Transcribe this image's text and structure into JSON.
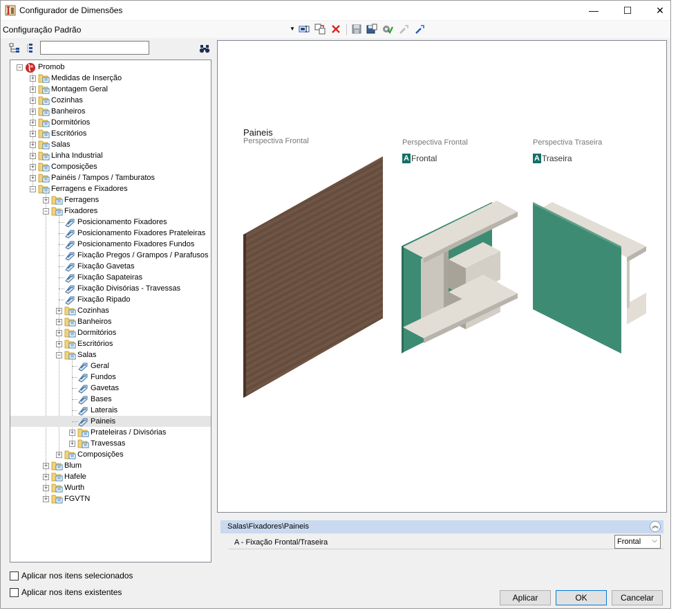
{
  "window": {
    "title": "Configurador de Dimensões",
    "minimize": "—",
    "maximize": "☐",
    "close": "✕"
  },
  "toolbar": {
    "config_label": "Configuração Padrão"
  },
  "search": {
    "value": "",
    "placeholder": ""
  },
  "tree": [
    {
      "label": "Promob",
      "depth": 0,
      "icon": "globe",
      "exp": "minus"
    },
    {
      "label": "Medidas de Inserção",
      "depth": 1,
      "icon": "folder",
      "exp": "plus"
    },
    {
      "label": "Montagem Geral",
      "depth": 1,
      "icon": "folder",
      "exp": "plus"
    },
    {
      "label": "Cozinhas",
      "depth": 1,
      "icon": "folder",
      "exp": "plus"
    },
    {
      "label": "Banheiros",
      "depth": 1,
      "icon": "folder",
      "exp": "plus"
    },
    {
      "label": "Dormitórios",
      "depth": 1,
      "icon": "folder",
      "exp": "plus"
    },
    {
      "label": "Escritórios",
      "depth": 1,
      "icon": "folder",
      "exp": "plus"
    },
    {
      "label": "Salas",
      "depth": 1,
      "icon": "folder",
      "exp": "plus"
    },
    {
      "label": "Linha Industrial",
      "depth": 1,
      "icon": "folder",
      "exp": "plus"
    },
    {
      "label": "Composições",
      "depth": 1,
      "icon": "folder",
      "exp": "plus"
    },
    {
      "label": "Painéis / Tampos / Tamburatos",
      "depth": 1,
      "icon": "folder",
      "exp": "plus"
    },
    {
      "label": "Ferragens e Fixadores",
      "depth": 1,
      "icon": "folder",
      "exp": "minus"
    },
    {
      "label": "Ferragens",
      "depth": 2,
      "icon": "folder",
      "exp": "plus"
    },
    {
      "label": "Fixadores",
      "depth": 2,
      "icon": "folder",
      "exp": "minus"
    },
    {
      "label": "Posicionamento Fixadores",
      "depth": 3,
      "icon": "tag",
      "exp": ""
    },
    {
      "label": "Posicionamento Fixadores Prateleiras",
      "depth": 3,
      "icon": "tag",
      "exp": ""
    },
    {
      "label": "Posicionamento Fixadores Fundos",
      "depth": 3,
      "icon": "tag",
      "exp": ""
    },
    {
      "label": "Fixação Pregos / Grampos / Parafusos",
      "depth": 3,
      "icon": "tag",
      "exp": ""
    },
    {
      "label": "Fixação Gavetas",
      "depth": 3,
      "icon": "tag",
      "exp": ""
    },
    {
      "label": "Fixação Sapateiras",
      "depth": 3,
      "icon": "tag",
      "exp": ""
    },
    {
      "label": "Fixação Divisórias - Travessas",
      "depth": 3,
      "icon": "tag",
      "exp": ""
    },
    {
      "label": "Fixação Ripado",
      "depth": 3,
      "icon": "tag",
      "exp": ""
    },
    {
      "label": "Cozinhas",
      "depth": 3,
      "icon": "folder",
      "exp": "plus"
    },
    {
      "label": "Banheiros",
      "depth": 3,
      "icon": "folder",
      "exp": "plus"
    },
    {
      "label": "Dormitórios",
      "depth": 3,
      "icon": "folder",
      "exp": "plus"
    },
    {
      "label": "Escritórios",
      "depth": 3,
      "icon": "folder",
      "exp": "plus"
    },
    {
      "label": "Salas",
      "depth": 3,
      "icon": "folder",
      "exp": "minus"
    },
    {
      "label": "Geral",
      "depth": 4,
      "icon": "tag",
      "exp": ""
    },
    {
      "label": "Fundos",
      "depth": 4,
      "icon": "tag",
      "exp": ""
    },
    {
      "label": "Gavetas",
      "depth": 4,
      "icon": "tag",
      "exp": ""
    },
    {
      "label": "Bases",
      "depth": 4,
      "icon": "tag",
      "exp": ""
    },
    {
      "label": "Laterais",
      "depth": 4,
      "icon": "tag",
      "exp": ""
    },
    {
      "label": "Paineis",
      "depth": 4,
      "icon": "tag",
      "exp": "",
      "selected": true
    },
    {
      "label": "Prateleiras / Divisórias",
      "depth": 4,
      "icon": "folder",
      "exp": "plus"
    },
    {
      "label": "Travessas",
      "depth": 4,
      "icon": "folder",
      "exp": "plus"
    },
    {
      "label": "Composições",
      "depth": 3,
      "icon": "folder",
      "exp": "plus"
    },
    {
      "label": "Blum",
      "depth": 2,
      "icon": "folder",
      "exp": "plus"
    },
    {
      "label": "Hafele",
      "depth": 2,
      "icon": "folder",
      "exp": "plus"
    },
    {
      "label": "Wurth",
      "depth": 2,
      "icon": "folder",
      "exp": "plus"
    },
    {
      "label": "FGVTN",
      "depth": 2,
      "icon": "folder",
      "exp": "plus"
    }
  ],
  "preview": {
    "title": "Paineis",
    "subtitle": "Perspectiva Frontal",
    "view1_title": "Perspectiva Frontal",
    "view1_badge_letter": "A",
    "view1_badge_text": "Frontal",
    "view2_title": "Perspectiva Traseira",
    "view2_badge_letter": "A",
    "view2_badge_text": "Traseira",
    "colors": {
      "wood": "#6b5141",
      "green": "#3e8b73",
      "shelf": "#e2ded6",
      "badge": "#127066"
    }
  },
  "properties": {
    "path": "Salas\\Fixadores\\Paineis",
    "row_label": "A - Fixação Frontal/Traseira",
    "row_value": "Frontal"
  },
  "options": {
    "apply_selected": "Aplicar nos itens selecionados",
    "apply_existing": "Aplicar nos itens existentes"
  },
  "buttons": {
    "apply": "Aplicar",
    "ok": "OK",
    "cancel": "Cancelar"
  }
}
